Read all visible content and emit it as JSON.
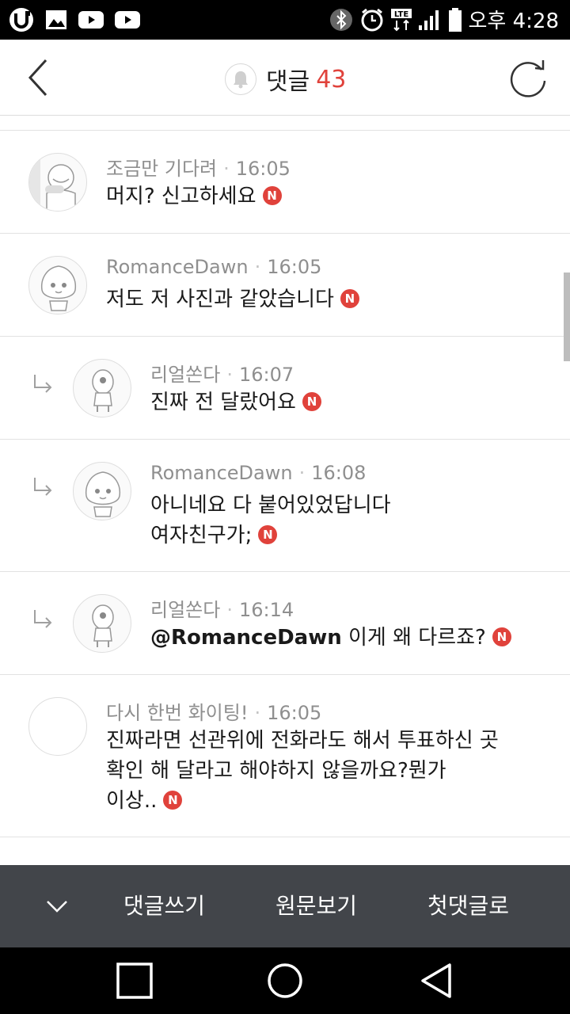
{
  "status_bar": {
    "time": "오후 4:28",
    "icons": [
      "u-plus-icon",
      "image-icon",
      "youtube-icon",
      "youtube-icon",
      "bluetooth-icon",
      "alarm-icon",
      "lte-icon",
      "signal-icon",
      "battery-icon"
    ],
    "lte_label": "LTE"
  },
  "header": {
    "title": "댓글",
    "count": "43"
  },
  "comments": [
    {
      "author": "조금만 기다려",
      "time": "16:05",
      "text": "머지? 신고하세요",
      "new_badge": "N",
      "reply": false
    },
    {
      "author": "RomanceDawn",
      "time": "16:05",
      "text": "저도 저 사진과 같았습니다",
      "new_badge": "N",
      "reply": false
    },
    {
      "author": "리얼쏜다",
      "time": "16:07",
      "text": "진짜 전 달랐어요",
      "new_badge": "N",
      "reply": true
    },
    {
      "author": "RomanceDawn",
      "time": "16:08",
      "text_line1": "아니네요 다 붙어있었답니다",
      "text_line2": "여자친구가;",
      "new_badge": "N",
      "reply": true
    },
    {
      "author": "리얼쏜다",
      "time": "16:14",
      "mention": "@RomanceDawn",
      "text": "이게 왜 다르죠?",
      "new_badge": "N",
      "reply": true
    },
    {
      "author": "다시 한번 화이팅!",
      "time": "16:05",
      "text_line1": "진짜라면 선관위에 전화라도 해서 투표하신 곳",
      "text_line2": "확인 해 달라고 해야하지 않을까요?뭔가",
      "text_line3": "이상..",
      "new_badge": "N",
      "reply": false
    }
  ],
  "bottom_bar": {
    "write_comment": "댓글쓰기",
    "view_original": "원문보기",
    "first_comment": "첫댓글로"
  },
  "colors": {
    "accent_red": "#e0423b",
    "action_bar_bg": "#42454a",
    "meta_gray": "#8f8f8f"
  }
}
